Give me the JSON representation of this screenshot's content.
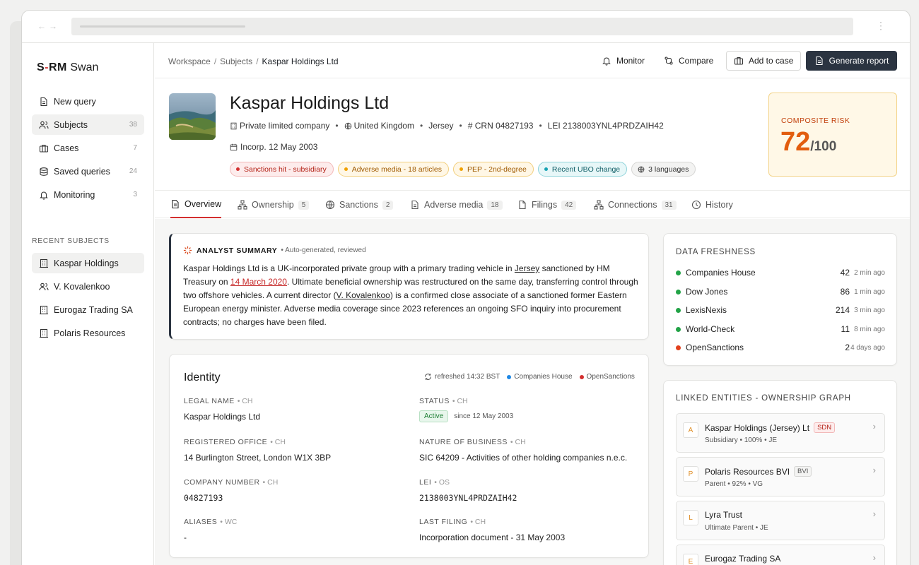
{
  "app": {
    "brand_mark": "S-RM",
    "brand_name": "Swan"
  },
  "sidebar": {
    "items": [
      {
        "label": "New query",
        "count": ""
      },
      {
        "label": "Subjects",
        "count": "38"
      },
      {
        "label": "Cases",
        "count": "7"
      },
      {
        "label": "Saved queries",
        "count": "24"
      },
      {
        "label": "Monitoring",
        "count": "3"
      }
    ],
    "recent_title": "RECENT SUBJECTS",
    "recent": [
      {
        "label": "Kaspar Holdings"
      },
      {
        "label": "V. Kovalenkoo"
      },
      {
        "label": "Eurogaz Trading SA"
      },
      {
        "label": "Polaris Resources"
      }
    ]
  },
  "breadcrumb": {
    "a": "Workspace",
    "b": "Subjects",
    "sep": "/",
    "current": "Kaspar Holdings Ltd"
  },
  "toolbar": {
    "monitor": "Monitor",
    "compare": "Compare",
    "add_to_case": "Add to case",
    "generate_report": "Generate report"
  },
  "subject": {
    "name": "Kaspar Holdings Ltd",
    "type": "Private limited company",
    "country": "United Kingdom",
    "jurisdiction": "Jersey",
    "crn": "# CRN 04827193",
    "lei": "LEI 2138003YNL4PRDZAIH42",
    "incorporated": "Incorp. 12 May 2003",
    "tags": [
      "Sanctions hit - subsidiary",
      "Adverse media - 18 articles",
      "PEP - 2nd-degree",
      "Recent UBO change",
      "3 languages"
    ]
  },
  "risk": {
    "label": "COMPOSITE RISK",
    "value": "72",
    "max": "/100"
  },
  "tabs": [
    {
      "label": "Overview",
      "count": ""
    },
    {
      "label": "Ownership",
      "count": "5"
    },
    {
      "label": "Sanctions",
      "count": "2"
    },
    {
      "label": "Adverse media",
      "count": "18"
    },
    {
      "label": "Filings",
      "count": "42"
    },
    {
      "label": "Connections",
      "count": "31"
    },
    {
      "label": "History",
      "count": ""
    }
  ],
  "summary": {
    "title": "ANALYST SUMMARY",
    "subtitle": "• Auto-generated, reviewed",
    "t1": "Kaspar Holdings Ltd is a UK-incorporated private group with a primary trading vehicle in ",
    "link1": "Jersey",
    "t2": " sanctioned by HM Treasury on ",
    "link2": "14 March 2020",
    "t3": ". Ultimate beneficial ownership was restructured on the same day, transferring control through two offshore vehicles. A current director (",
    "link3": "V. Kovalenkoo",
    "t4": ") is a confirmed close associate of a sanctioned former Eastern European energy minister. Adverse media coverage since 2023 references an ongoing SFO inquiry into procurement contracts; no charges have been filed."
  },
  "identity": {
    "title": "Identity",
    "refreshed": "refreshed 14:32 BST",
    "sources": [
      "Companies House",
      "OpenSanctions"
    ],
    "source_colors": [
      "#1e88e5",
      "#d32f2f"
    ],
    "fields": [
      {
        "label": "LEGAL NAME",
        "src": "• CH",
        "value": "Kaspar Holdings Ltd"
      },
      {
        "label": "STATUS",
        "src": "• CH",
        "value": "Active",
        "since": "since 12 May 2003"
      },
      {
        "label": "REGISTERED OFFICE",
        "src": "• CH",
        "value": "14 Burlington Street, London W1X 3BP"
      },
      {
        "label": "NATURE OF BUSINESS",
        "src": "• CH",
        "value": "SIC 64209 - Activities of other holding companies n.e.c."
      },
      {
        "label": "COMPANY NUMBER",
        "src": "• CH",
        "value": "04827193"
      },
      {
        "label": "LEI",
        "src": "• OS",
        "value": "2138003YNL4PRDZAIH42"
      },
      {
        "label": "ALIASES",
        "src": "• WC",
        "value": "-"
      },
      {
        "label": "LAST FILING",
        "src": "• CH",
        "value": "Incorporation document - 31 May 2003"
      }
    ]
  },
  "freshness": {
    "title": "DATA FRESHNESS",
    "rows": [
      {
        "name": "Companies House",
        "count": "42",
        "time": "2 min ago",
        "color": "#22a347"
      },
      {
        "name": "Dow Jones",
        "count": "86",
        "time": "1 min ago",
        "color": "#22a347"
      },
      {
        "name": "LexisNexis",
        "count": "214",
        "time": "3 min ago",
        "color": "#22a347"
      },
      {
        "name": "World-Check",
        "count": "11",
        "time": "8 min ago",
        "color": "#22a347"
      },
      {
        "name": "OpenSanctions",
        "count": "2",
        "time": "4 days ago",
        "color": "#e2401c"
      }
    ]
  },
  "linked": {
    "title": "LINKED ENTITIES - OWNERSHIP GRAPH",
    "entities": [
      {
        "letter": "A",
        "name": "Kaspar Holdings (Jersey) Lt",
        "flag": "SDN",
        "sub": "Subsidiary  •  100%  •  JE"
      },
      {
        "letter": "P",
        "name": "Polaris Resources BVI",
        "flag": "BVI",
        "sub": "Parent  •  92%  •  VG"
      },
      {
        "letter": "L",
        "name": "Lyra Trust",
        "flag": "",
        "sub": "Ultimate Parent  •  JE"
      },
      {
        "letter": "E",
        "name": "Eurogaz Trading SA",
        "flag": "",
        "sub": ""
      }
    ]
  }
}
